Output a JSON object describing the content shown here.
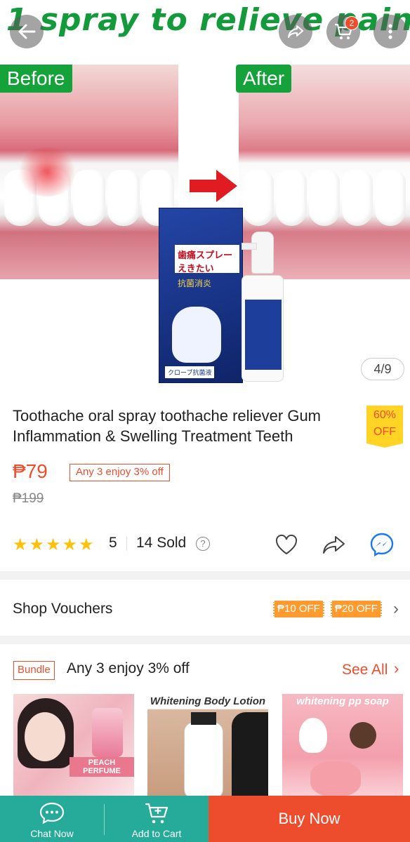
{
  "hero": {
    "banner_text": "1 spray to relieve pain",
    "before_label": "Before",
    "after_label": "After",
    "pager": "4/9",
    "cart_count": "2"
  },
  "product": {
    "title": "Toothache oral spray toothache reliever Gum Inflammation & Swelling Treatment Teeth",
    "discount_percent": "60%",
    "discount_off": "OFF",
    "price": "₱79",
    "promo": "Any 3 enjoy 3% off",
    "original_price": "₱199",
    "rating": "5",
    "star_count": 5,
    "sold": "14 Sold"
  },
  "vouchers": {
    "label": "Shop Vouchers",
    "items": [
      "₱10 OFF",
      "₱20 OFF"
    ]
  },
  "bundle": {
    "tag": "Bundle",
    "title": "Any 3 enjoy 3% off",
    "see_all": "See All",
    "items": [
      {
        "caption": "PEACH PERFUME"
      },
      {
        "caption": "Whitening Body Lotion"
      },
      {
        "caption": "whitening pp soap"
      }
    ]
  },
  "bottom_bar": {
    "chat": "Chat Now",
    "add_to_cart": "Add to Cart",
    "buy_now": "Buy Now"
  },
  "colors": {
    "accent": "#ee4d2d",
    "teal": "#26aa99",
    "star": "#ffc107",
    "banner_green": "#139a3b"
  }
}
